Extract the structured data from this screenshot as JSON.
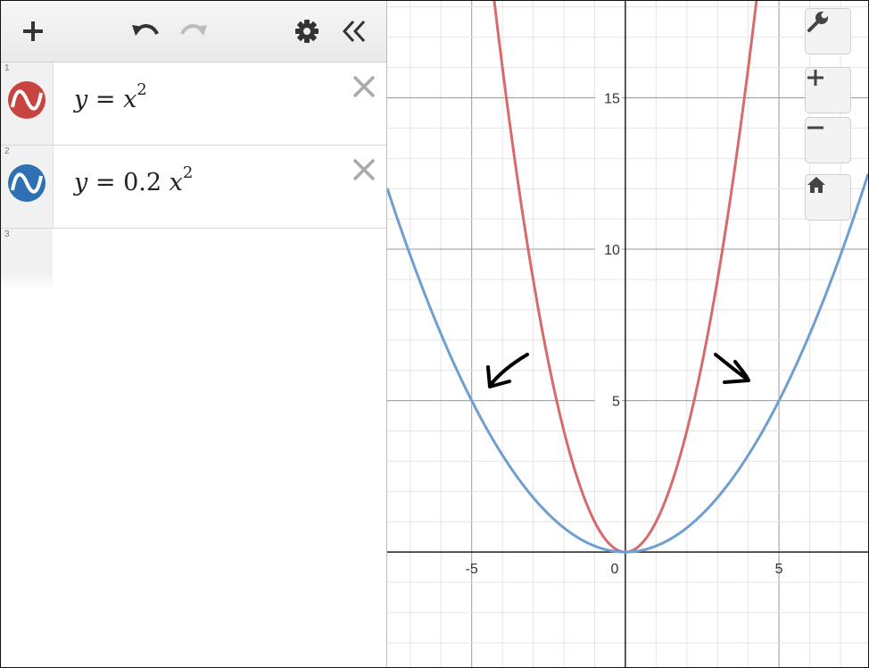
{
  "toolbar": {
    "add_icon": "plus-icon",
    "undo_icon": "undo-icon",
    "redo_icon": "redo-icon",
    "settings_icon": "gear-icon",
    "collapse_icon": "double-chevron-left-icon"
  },
  "expressions": [
    {
      "index": "1",
      "lhs": "y",
      "eq": " = ",
      "coef": "",
      "var": "x",
      "exp": "2",
      "color": "#c74440"
    },
    {
      "index": "2",
      "lhs": "y",
      "eq": " = ",
      "coef": "0.2 ",
      "var": "x",
      "exp": "2",
      "color": "#2d70b3"
    },
    {
      "index": "3"
    }
  ],
  "graph_controls": [
    "wrench-icon",
    "zoom-in-icon",
    "zoom-out-icon",
    "home-icon"
  ],
  "chart_data": {
    "type": "line",
    "x_range": [
      -7.75,
      7.9
    ],
    "y_range": [
      -3.8,
      18.2
    ],
    "grid": true,
    "x_ticks": [
      "-5",
      "0",
      "5"
    ],
    "y_ticks": [
      "5",
      "10",
      "15"
    ],
    "series": [
      {
        "name": "y = x^2",
        "color": "#c74440",
        "formula": "x^2",
        "coefficient": 1
      },
      {
        "name": "y = 0.2x^2",
        "color": "#388c46",
        "formula": "0.2x^2",
        "coefficient": 0.2
      }
    ],
    "series_colors": [
      "#d76a6a",
      "#6f9fd1"
    ],
    "annotations": [
      "hand-drawn-arrow-left",
      "hand-drawn-arrow-right"
    ]
  }
}
